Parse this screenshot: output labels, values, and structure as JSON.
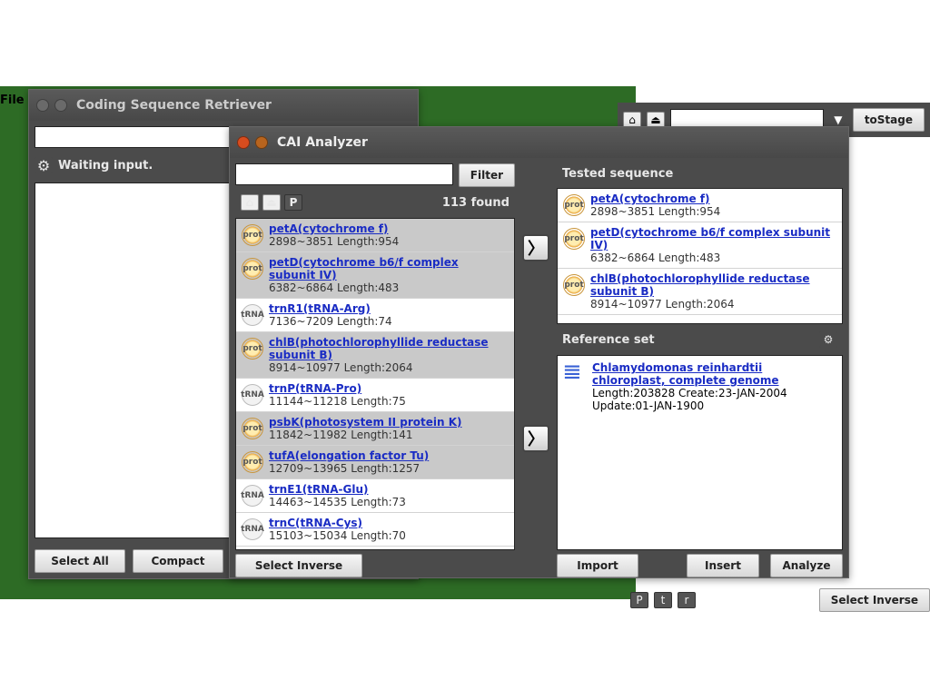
{
  "background": {
    "file_label": "File"
  },
  "top_right": {
    "toStage": "toStage"
  },
  "bottom_right": {
    "btn_p": "P",
    "btn_t": "t",
    "btn_r": "r",
    "select_inverse": "Select Inverse"
  },
  "csr": {
    "title": "Coding Sequence Retriever",
    "status": "Waiting input.",
    "select_all": "Select All",
    "compact": "Compact"
  },
  "cai": {
    "title": "CAI Analyzer",
    "filter_label": "Filter",
    "filter_value": "",
    "found_label": "113 found",
    "select_inverse": "Select Inverse",
    "toolbar": {
      "home": "⌂",
      "eject": "⏏",
      "p": "P"
    },
    "list": [
      {
        "type": "prot",
        "sel": true,
        "name": "petA(cytochrome f)",
        "pos": "2898~3851 Length:954"
      },
      {
        "type": "prot",
        "sel": true,
        "name": "petD(cytochrome b6/f complex subunit IV)",
        "pos": "6382~6864 Length:483"
      },
      {
        "type": "trna",
        "sel": false,
        "name": "trnR1(tRNA-Arg)",
        "pos": "7136~7209 Length:74"
      },
      {
        "type": "prot",
        "sel": true,
        "name": "chlB(photochlorophyllide reductase subunit B)",
        "pos": "8914~10977 Length:2064"
      },
      {
        "type": "trna",
        "sel": false,
        "name": "trnP(tRNA-Pro)",
        "pos": "11144~11218 Length:75"
      },
      {
        "type": "prot",
        "sel": true,
        "name": "psbK(photosystem II protein K)",
        "pos": "11842~11982 Length:141"
      },
      {
        "type": "prot",
        "sel": true,
        "name": "tufA(elongation factor Tu)",
        "pos": "12709~13965 Length:1257"
      },
      {
        "type": "trna",
        "sel": false,
        "name": "trnE1(tRNA-Glu)",
        "pos": "14463~14535 Length:73"
      },
      {
        "type": "trna",
        "sel": false,
        "name": "trnC(tRNA-Cys)",
        "pos": "15103~15034 Length:70"
      }
    ],
    "tested_title": "Tested sequence",
    "tested": [
      {
        "type": "prot",
        "name": "petA(cytochrome f)",
        "pos": "2898~3851 Length:954"
      },
      {
        "type": "prot",
        "name": "petD(cytochrome b6/f complex subunit IV)",
        "pos": "6382~6864 Length:483"
      },
      {
        "type": "prot",
        "name": "chlB(photochlorophyllide reductase subunit B)",
        "pos": "8914~10977 Length:2064"
      }
    ],
    "reference_title": "Reference set",
    "reference": {
      "name": "Chlamydomonas reinhardtii chloroplast, complete genome",
      "meta1": "Length:203828 Create:23-JAN-2004",
      "meta2": "Update:01-JAN-1900"
    },
    "import": "Import",
    "insert": "Insert",
    "analyze": "Analyze"
  }
}
